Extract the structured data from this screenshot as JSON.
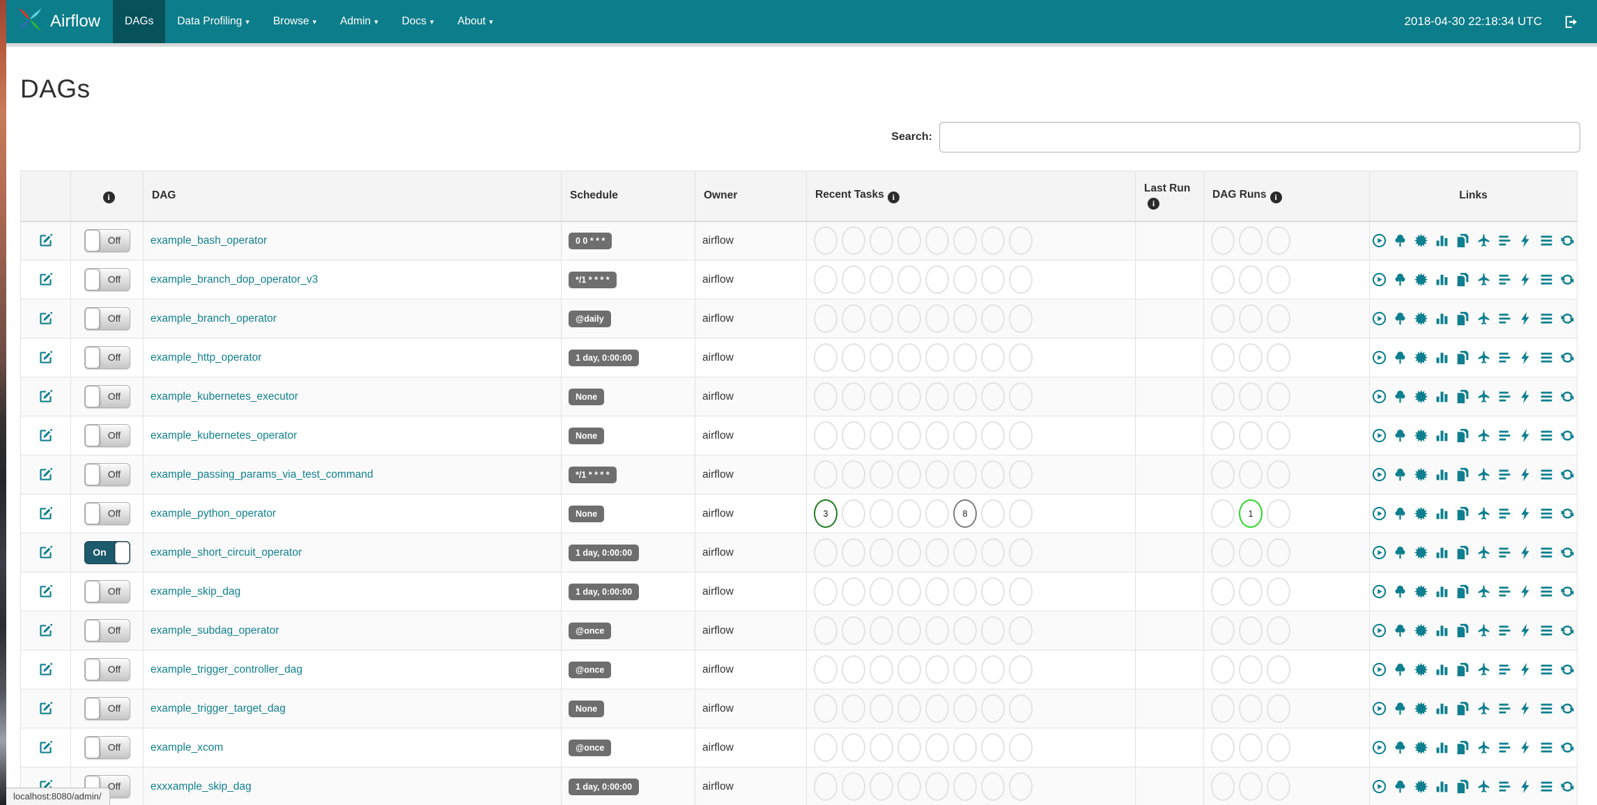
{
  "navbar": {
    "brand": "Airflow",
    "items": [
      {
        "label": "DAGs",
        "active": true,
        "caret": false
      },
      {
        "label": "Data Profiling",
        "active": false,
        "caret": true
      },
      {
        "label": "Browse",
        "active": false,
        "caret": true
      },
      {
        "label": "Admin",
        "active": false,
        "caret": true
      },
      {
        "label": "Docs",
        "active": false,
        "caret": true
      },
      {
        "label": "About",
        "active": false,
        "caret": true
      }
    ],
    "clock": "2018-04-30 22:18:34 UTC",
    "icons": {
      "logo": "airflow-pinwheel",
      "signout": "sign-out-icon"
    }
  },
  "page": {
    "title": "DAGs",
    "search_label": "Search:",
    "search_value": "",
    "status_bar": "localhost:8080/admin/"
  },
  "table": {
    "headers": [
      {
        "label": "",
        "info": false,
        "align": "left"
      },
      {
        "label": "",
        "info": true,
        "align": "center"
      },
      {
        "label": "DAG",
        "info": false,
        "align": "left"
      },
      {
        "label": "Schedule",
        "info": false,
        "align": "left"
      },
      {
        "label": "Owner",
        "info": false,
        "align": "left"
      },
      {
        "label": "Recent Tasks",
        "info": true,
        "align": "left"
      },
      {
        "label": "Last Run",
        "info": true,
        "align": "left"
      },
      {
        "label": "DAG Runs",
        "info": true,
        "align": "left"
      },
      {
        "label": "Links",
        "info": false,
        "align": "center"
      }
    ],
    "recent_task_slots": 8,
    "dag_run_slots": 3,
    "empty_circle_color": "#e3e3e3",
    "rows": [
      {
        "dag_name": "example_bash_operator",
        "toggle": "Off",
        "schedule": "0 0 * * *",
        "owner": "airflow",
        "last_run": "",
        "recent_tasks": [],
        "dag_runs": []
      },
      {
        "dag_name": "example_branch_dop_operator_v3",
        "toggle": "Off",
        "schedule": "*/1 * * * *",
        "owner": "airflow",
        "last_run": "",
        "recent_tasks": [],
        "dag_runs": []
      },
      {
        "dag_name": "example_branch_operator",
        "toggle": "Off",
        "schedule": "@daily",
        "owner": "airflow",
        "last_run": "",
        "recent_tasks": [],
        "dag_runs": []
      },
      {
        "dag_name": "example_http_operator",
        "toggle": "Off",
        "schedule": "1 day, 0:00:00",
        "owner": "airflow",
        "last_run": "",
        "recent_tasks": [],
        "dag_runs": []
      },
      {
        "dag_name": "example_kubernetes_executor",
        "toggle": "Off",
        "schedule": "None",
        "owner": "airflow",
        "last_run": "",
        "recent_tasks": [],
        "dag_runs": []
      },
      {
        "dag_name": "example_kubernetes_operator",
        "toggle": "Off",
        "schedule": "None",
        "owner": "airflow",
        "last_run": "",
        "recent_tasks": [],
        "dag_runs": []
      },
      {
        "dag_name": "example_passing_params_via_test_command",
        "toggle": "Off",
        "schedule": "*/1 * * * *",
        "owner": "airflow",
        "last_run": "",
        "recent_tasks": [],
        "dag_runs": []
      },
      {
        "dag_name": "example_python_operator",
        "toggle": "Off",
        "schedule": "None",
        "owner": "airflow",
        "last_run": "",
        "recent_tasks": [
          {
            "slot": 0,
            "count": "3",
            "color": "#1f7a1f"
          },
          {
            "slot": 5,
            "count": "8",
            "color": "#7d7d7d"
          }
        ],
        "dag_runs": [
          {
            "slot": 1,
            "count": "1",
            "color": "#2bd62b"
          }
        ]
      },
      {
        "dag_name": "example_short_circuit_operator",
        "toggle": "On",
        "schedule": "1 day, 0:00:00",
        "owner": "airflow",
        "last_run": "",
        "recent_tasks": [],
        "dag_runs": []
      },
      {
        "dag_name": "example_skip_dag",
        "toggle": "Off",
        "schedule": "1 day, 0:00:00",
        "owner": "airflow",
        "last_run": "",
        "recent_tasks": [],
        "dag_runs": []
      },
      {
        "dag_name": "example_subdag_operator",
        "toggle": "Off",
        "schedule": "@once",
        "owner": "airflow",
        "last_run": "",
        "recent_tasks": [],
        "dag_runs": []
      },
      {
        "dag_name": "example_trigger_controller_dag",
        "toggle": "Off",
        "schedule": "@once",
        "owner": "airflow",
        "last_run": "",
        "recent_tasks": [],
        "dag_runs": []
      },
      {
        "dag_name": "example_trigger_target_dag",
        "toggle": "Off",
        "schedule": "None",
        "owner": "airflow",
        "last_run": "",
        "recent_tasks": [],
        "dag_runs": []
      },
      {
        "dag_name": "example_xcom",
        "toggle": "Off",
        "schedule": "@once",
        "owner": "airflow",
        "last_run": "",
        "recent_tasks": [],
        "dag_runs": []
      },
      {
        "dag_name": "exxxample_skip_dag",
        "toggle": "Off",
        "schedule": "1 day, 0:00:00",
        "owner": "airflow",
        "last_run": "",
        "recent_tasks": [],
        "dag_runs": []
      }
    ],
    "link_icons": [
      "play-circle",
      "tree",
      "starburst-graph",
      "bar-chart",
      "copy-pages",
      "plane",
      "align-left-bars",
      "lightning-bolt",
      "list-lines",
      "refresh"
    ]
  },
  "colors": {
    "navbar": "#0c7d8a",
    "navbar_active": "#07515b",
    "accent_teal": "#11808f",
    "badge_gray": "#6e6e6e",
    "toggle_on": "#1d5a6c",
    "success_green": "#1f7a1f",
    "running_lime": "#2bd62b",
    "queued_gray": "#7d7d7d"
  }
}
